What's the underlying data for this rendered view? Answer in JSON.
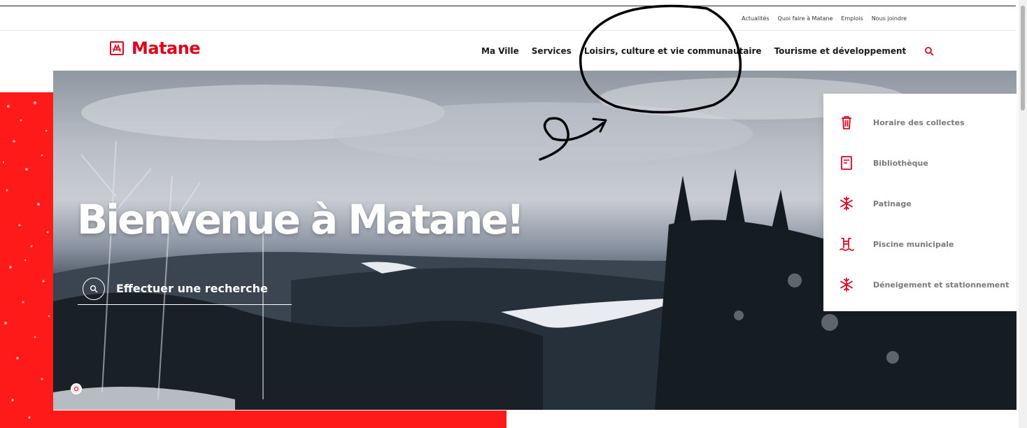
{
  "utility_nav": [
    "Actualités",
    "Quoi faire à Matane",
    "Emplois",
    "Nous joindre"
  ],
  "brand": {
    "name": "Matane",
    "icon": "city-crest-icon"
  },
  "main_nav": {
    "items": [
      "Ma Ville",
      "Services",
      "Loisirs, culture et vie communautaire",
      "Tourisme et développement"
    ],
    "search_icon": "search-icon"
  },
  "hero": {
    "title": "Bienvenue à Matane!",
    "search_label": "Effectuer une recherche",
    "search_icon": "search-icon"
  },
  "quick_links": [
    {
      "label": "Horaire des collectes",
      "icon": "trash-bin-icon"
    },
    {
      "label": "Bibliothèque",
      "icon": "book-icon"
    },
    {
      "label": "Patinage",
      "icon": "snowflake-icon"
    },
    {
      "label": "Piscine municipale",
      "icon": "pool-ladder-icon"
    },
    {
      "label": "Déneigement et stationnement",
      "icon": "snowflake-icon"
    }
  ],
  "colors": {
    "brand_red": "#e3001b",
    "band_red": "#ff1a1a",
    "text_dark": "#1a1a1a",
    "text_muted": "#7a7a7a"
  }
}
